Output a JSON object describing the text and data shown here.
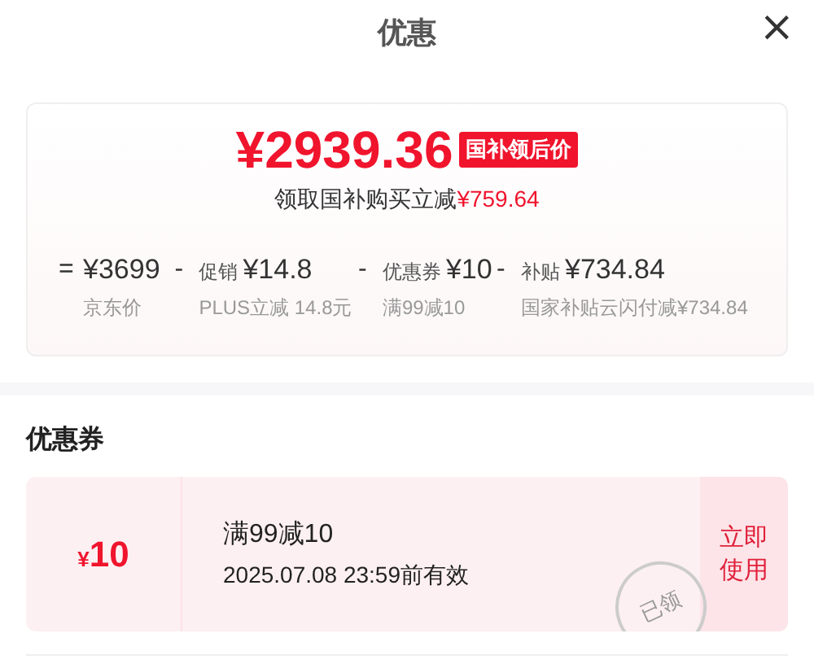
{
  "header": {
    "title": "优惠",
    "close": "×"
  },
  "summary": {
    "price": "¥2939.36",
    "badge": "国补领后价",
    "subtitle": "领取国补购买立减**¥759.64**"
  },
  "breakdown": [
    {
      "op": "=",
      "amount": "¥3699",
      "note": "京东价"
    },
    {
      "op": "-",
      "label": "促销",
      "amount": "¥14.8",
      "note": "PLUS立减 14.8元"
    },
    {
      "op": "-",
      "label": "优惠券",
      "amount": "¥10",
      "note": "满99减10"
    },
    {
      "op": "-",
      "label": "补贴",
      "amount": "¥734.84",
      "note": "国家补贴云闪付减¥734.84"
    }
  ],
  "coupons_section": {
    "title": "优惠券"
  },
  "coupons": [
    {
      "value": "10",
      "currency": "¥",
      "condition": "满99减10",
      "validity": "2025.07.08 23:59前有效",
      "action": "立即使用",
      "claimed": true,
      "stamp": "已领"
    }
  ]
}
